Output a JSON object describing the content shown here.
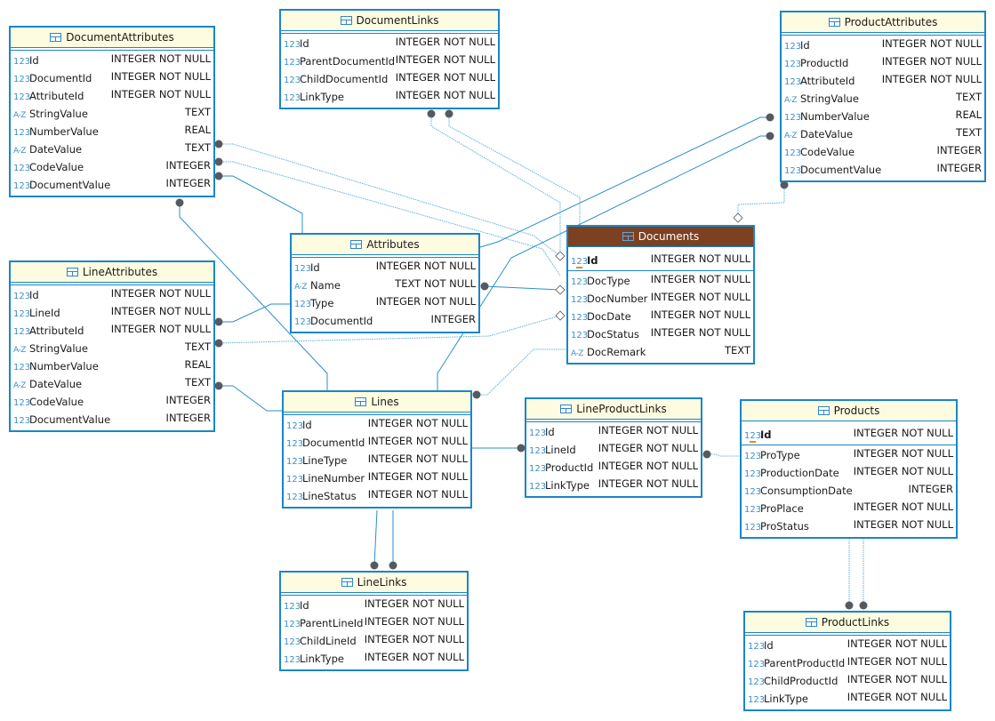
{
  "diagram": {
    "tables": [
      {
        "id": "DocumentAttributes",
        "title": "DocumentAttributes",
        "selected": false,
        "pk": null,
        "columns": [
          {
            "name": "Id",
            "type": "INTEGER NOT NULL",
            "kind": "num"
          },
          {
            "name": "DocumentId",
            "type": "INTEGER NOT NULL",
            "kind": "num"
          },
          {
            "name": "AttributeId",
            "type": "INTEGER NOT NULL",
            "kind": "num"
          },
          {
            "name": "StringValue",
            "type": "TEXT",
            "kind": "text"
          },
          {
            "name": "NumberValue",
            "type": "REAL",
            "kind": "num"
          },
          {
            "name": "DateValue",
            "type": "TEXT",
            "kind": "text"
          },
          {
            "name": "CodeValue",
            "type": "INTEGER",
            "kind": "num"
          },
          {
            "name": "DocumentValue",
            "type": "INTEGER",
            "kind": "num"
          }
        ]
      },
      {
        "id": "DocumentLinks",
        "title": "DocumentLinks",
        "selected": false,
        "pk": null,
        "columns": [
          {
            "name": "Id",
            "type": "INTEGER NOT NULL",
            "kind": "num"
          },
          {
            "name": "ParentDocumentId",
            "type": "INTEGER NOT NULL",
            "kind": "num"
          },
          {
            "name": "ChildDocumentId",
            "type": "INTEGER NOT NULL",
            "kind": "num"
          },
          {
            "name": "LinkType",
            "type": "INTEGER NOT NULL",
            "kind": "num"
          }
        ]
      },
      {
        "id": "ProductAttributes",
        "title": "ProductAttributes",
        "selected": false,
        "pk": null,
        "columns": [
          {
            "name": "Id",
            "type": "INTEGER NOT NULL",
            "kind": "num"
          },
          {
            "name": "ProductId",
            "type": "INTEGER NOT NULL",
            "kind": "num"
          },
          {
            "name": "AttributeId",
            "type": "INTEGER NOT NULL",
            "kind": "num"
          },
          {
            "name": "StringValue",
            "type": "TEXT",
            "kind": "text"
          },
          {
            "name": "NumberValue",
            "type": "REAL",
            "kind": "num"
          },
          {
            "name": "DateValue",
            "type": "TEXT",
            "kind": "text"
          },
          {
            "name": "CodeValue",
            "type": "INTEGER",
            "kind": "num"
          },
          {
            "name": "DocumentValue",
            "type": "INTEGER",
            "kind": "num"
          }
        ]
      },
      {
        "id": "Attributes",
        "title": "Attributes",
        "selected": false,
        "pk": null,
        "columns": [
          {
            "name": "Id",
            "type": "INTEGER NOT NULL",
            "kind": "num"
          },
          {
            "name": "Name",
            "type": "TEXT NOT NULL",
            "kind": "text"
          },
          {
            "name": "Type",
            "type": "INTEGER NOT NULL",
            "kind": "num"
          },
          {
            "name": "DocumentId",
            "type": "INTEGER",
            "kind": "num"
          }
        ]
      },
      {
        "id": "Documents",
        "title": "Documents",
        "selected": true,
        "pk": {
          "name": "Id",
          "type": "INTEGER NOT NULL",
          "kind": "num"
        },
        "columns": [
          {
            "name": "DocType",
            "type": "INTEGER NOT NULL",
            "kind": "num"
          },
          {
            "name": "DocNumber",
            "type": "INTEGER NOT NULL",
            "kind": "num"
          },
          {
            "name": "DocDate",
            "type": "INTEGER NOT NULL",
            "kind": "num"
          },
          {
            "name": "DocStatus",
            "type": "INTEGER NOT NULL",
            "kind": "num"
          },
          {
            "name": "DocRemark",
            "type": "TEXT",
            "kind": "text"
          }
        ]
      },
      {
        "id": "LineAttributes",
        "title": "LineAttributes",
        "selected": false,
        "pk": null,
        "columns": [
          {
            "name": "Id",
            "type": "INTEGER NOT NULL",
            "kind": "num"
          },
          {
            "name": "LineId",
            "type": "INTEGER NOT NULL",
            "kind": "num"
          },
          {
            "name": "AttributeId",
            "type": "INTEGER NOT NULL",
            "kind": "num"
          },
          {
            "name": "StringValue",
            "type": "TEXT",
            "kind": "text"
          },
          {
            "name": "NumberValue",
            "type": "REAL",
            "kind": "num"
          },
          {
            "name": "DateValue",
            "type": "TEXT",
            "kind": "text"
          },
          {
            "name": "CodeValue",
            "type": "INTEGER",
            "kind": "num"
          },
          {
            "name": "DocumentValue",
            "type": "INTEGER",
            "kind": "num"
          }
        ]
      },
      {
        "id": "Lines",
        "title": "Lines",
        "selected": false,
        "pk": null,
        "columns": [
          {
            "name": "Id",
            "type": "INTEGER NOT NULL",
            "kind": "num"
          },
          {
            "name": "DocumentId",
            "type": "INTEGER NOT NULL",
            "kind": "num"
          },
          {
            "name": "LineType",
            "type": "INTEGER NOT NULL",
            "kind": "num"
          },
          {
            "name": "LineNumber",
            "type": "INTEGER NOT NULL",
            "kind": "num"
          },
          {
            "name": "LineStatus",
            "type": "INTEGER NOT NULL",
            "kind": "num"
          }
        ]
      },
      {
        "id": "LineProductLinks",
        "title": "LineProductLinks",
        "selected": false,
        "pk": null,
        "columns": [
          {
            "name": "Id",
            "type": "INTEGER NOT NULL",
            "kind": "num"
          },
          {
            "name": "LineId",
            "type": "INTEGER NOT NULL",
            "kind": "num"
          },
          {
            "name": "ProductId",
            "type": "INTEGER NOT NULL",
            "kind": "num"
          },
          {
            "name": "LinkType",
            "type": "INTEGER NOT NULL",
            "kind": "num"
          }
        ]
      },
      {
        "id": "Products",
        "title": "Products",
        "selected": false,
        "pk": {
          "name": "Id",
          "type": "INTEGER NOT NULL",
          "kind": "num"
        },
        "columns": [
          {
            "name": "ProType",
            "type": "INTEGER NOT NULL",
            "kind": "num"
          },
          {
            "name": "ProductionDate",
            "type": "INTEGER NOT NULL",
            "kind": "num"
          },
          {
            "name": "ConsumptionDate",
            "type": "INTEGER",
            "kind": "num"
          },
          {
            "name": "ProPlace",
            "type": "INTEGER NOT NULL",
            "kind": "num"
          },
          {
            "name": "ProStatus",
            "type": "INTEGER NOT NULL",
            "kind": "num"
          }
        ]
      },
      {
        "id": "LineLinks",
        "title": "LineLinks",
        "selected": false,
        "pk": null,
        "columns": [
          {
            "name": "Id",
            "type": "INTEGER NOT NULL",
            "kind": "num"
          },
          {
            "name": "ParentLineId",
            "type": "INTEGER NOT NULL",
            "kind": "num"
          },
          {
            "name": "ChildLineId",
            "type": "INTEGER NOT NULL",
            "kind": "num"
          },
          {
            "name": "LinkType",
            "type": "INTEGER NOT NULL",
            "kind": "num"
          }
        ]
      },
      {
        "id": "ProductLinks",
        "title": "ProductLinks",
        "selected": false,
        "pk": null,
        "columns": [
          {
            "name": "Id",
            "type": "INTEGER NOT NULL",
            "kind": "num"
          },
          {
            "name": "ParentProductId",
            "type": "INTEGER NOT NULL",
            "kind": "num"
          },
          {
            "name": "ChildProductId",
            "type": "INTEGER NOT NULL",
            "kind": "num"
          },
          {
            "name": "LinkType",
            "type": "INTEGER NOT NULL",
            "kind": "num"
          }
        ]
      }
    ],
    "type_icons": {
      "num": "123",
      "text": "A-Z"
    },
    "colors": {
      "border": "#1a86c6",
      "header": "#fdfbe0",
      "selected_header": "#7d4021",
      "link": "#2a8fcc",
      "endpoint": "#555a60"
    }
  }
}
